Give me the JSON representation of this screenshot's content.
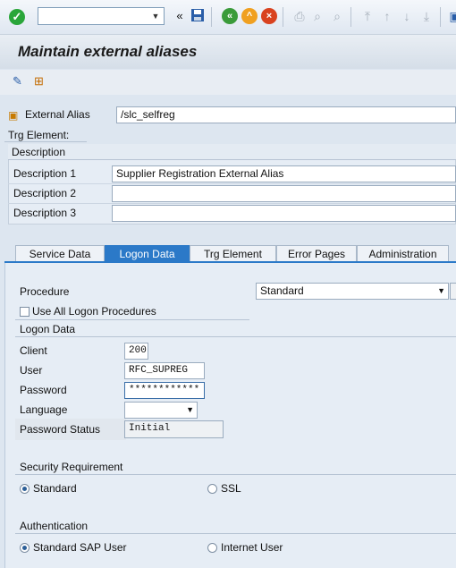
{
  "toolbar": {
    "command_field_value": "",
    "icons": [
      "enter-icon",
      "back-double-icon",
      "save-icon",
      "back-icon",
      "exit-icon",
      "cancel-icon",
      "print-icon",
      "find-icon",
      "find-next-icon",
      "first-page-icon",
      "prev-page-icon",
      "next-page-icon",
      "last-page-icon",
      "create-session-icon"
    ]
  },
  "title": "Maintain external aliases",
  "header": {
    "external_alias_label": "External Alias",
    "external_alias_value": "/slc_selfreg",
    "trg_element_label": "Trg Element:"
  },
  "description": {
    "section_title": "Description",
    "rows": [
      {
        "label": "Description 1",
        "value": "Supplier Registration External Alias"
      },
      {
        "label": "Description 2",
        "value": ""
      },
      {
        "label": "Description 3",
        "value": ""
      }
    ]
  },
  "tabs": [
    {
      "label": "Service Data"
    },
    {
      "label": "Logon Data",
      "active": true
    },
    {
      "label": "Trg Element"
    },
    {
      "label": "Error Pages"
    },
    {
      "label": "Administration"
    }
  ],
  "logon": {
    "procedure_label": "Procedure",
    "procedure_value": "Standard",
    "use_all_label": "Use All Logon Procedures",
    "use_all_checked": false,
    "logon_data_title": "Logon Data",
    "client_label": "Client",
    "client_value": "200",
    "user_label": "User",
    "user_value": "RFC_SUPREG",
    "password_label": "Password",
    "password_value": "************",
    "language_label": "Language",
    "language_value": "",
    "password_status_label": "Password Status",
    "password_status_value": "Initial"
  },
  "security": {
    "title": "Security Requirement",
    "options": [
      {
        "label": "Standard",
        "selected": true
      },
      {
        "label": "SSL",
        "selected": false
      }
    ]
  },
  "authentication": {
    "title": "Authentication",
    "options": [
      {
        "label": "Standard SAP User",
        "selected": true
      },
      {
        "label": "Internet User",
        "selected": false
      }
    ]
  },
  "colors": {
    "tab_active": "#2b79c8",
    "ok_green": "#2aa63a"
  }
}
